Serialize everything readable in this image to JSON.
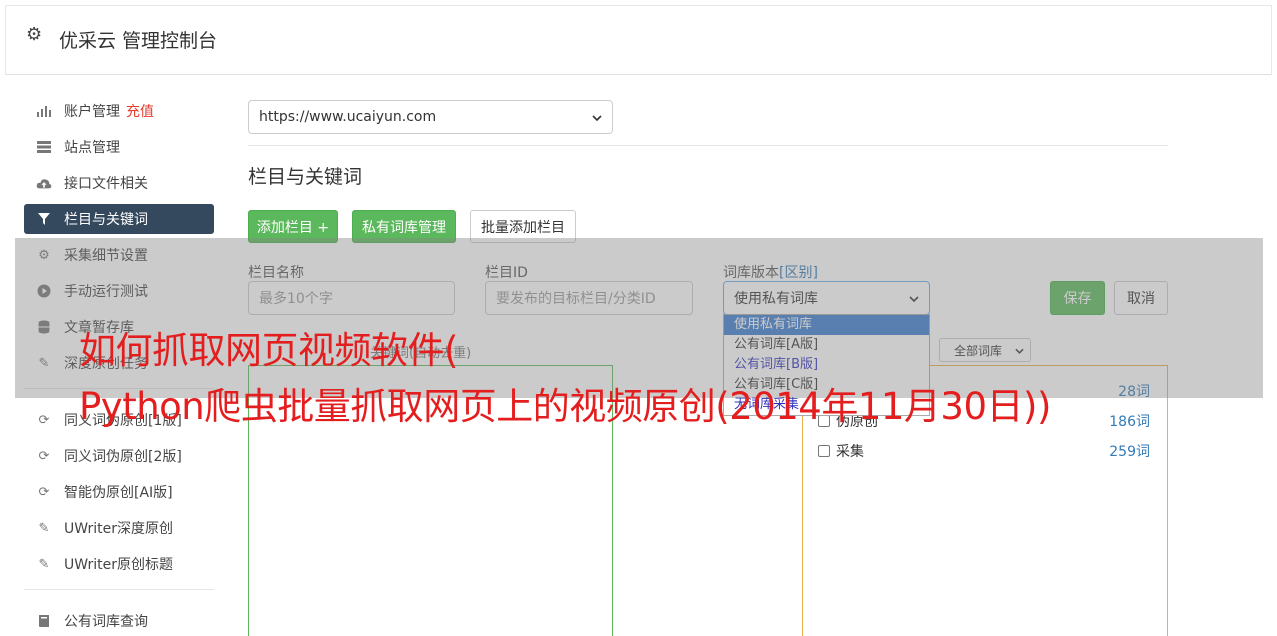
{
  "header": {
    "title": "优采云 管理控制台"
  },
  "sidebar": {
    "group1": [
      {
        "label": "账户管理",
        "extra": "充值",
        "icon": "bar-chart-icon"
      },
      {
        "label": "站点管理",
        "icon": "server-icon"
      },
      {
        "label": "接口文件相关",
        "icon": "cloud-upload-icon"
      },
      {
        "label": "栏目与关键词",
        "icon": "filter-icon",
        "active": true
      },
      {
        "label": "采集细节设置",
        "icon": "gears-icon"
      },
      {
        "label": "手动运行测试",
        "icon": "play-circle-icon"
      },
      {
        "label": "文章暂存库",
        "icon": "database-icon"
      },
      {
        "label": "深度原创任务",
        "icon": "edit-icon"
      }
    ],
    "group2": [
      {
        "label": "同义词伪原创[1版]",
        "icon": "refresh-icon"
      },
      {
        "label": "同义词伪原创[2版]",
        "icon": "refresh-icon"
      },
      {
        "label": "智能伪原创[AI版]",
        "icon": "refresh-icon"
      },
      {
        "label": "UWriter深度原创",
        "icon": "edit-icon"
      },
      {
        "label": "UWriter原创标题",
        "icon": "edit-icon"
      }
    ],
    "group3": [
      {
        "label": "公有词库查询",
        "icon": "book-icon"
      }
    ]
  },
  "main": {
    "site_select": "https://www.ucaiyun.com",
    "section_title": "栏目与关键词",
    "buttons": {
      "add_column": "添加栏目 +",
      "private_lib": "私有词库管理",
      "batch_add": "批量添加栏目"
    },
    "form": {
      "name_label": "栏目名称",
      "name_placeholder": "最多10个字",
      "id_label": "栏目ID",
      "id_placeholder": "要发布的目标栏目/分类ID",
      "lib_label": "词库版本",
      "lib_label_link": "[区别]",
      "lib_selected": "使用私有词库",
      "save": "保存",
      "cancel": "取消"
    },
    "dropdown_options": [
      "使用私有词库",
      "公有词库[A版]",
      "公有词库[B版]",
      "公有词库[C版]",
      "无词库采集"
    ],
    "keywords_hint": "关键词(自动去重)",
    "filter_select": "全部词库",
    "keyword_rows": [
      {
        "name": "",
        "count": "28词"
      },
      {
        "name": "伪原创",
        "count": "186词"
      },
      {
        "name": "采集",
        "count": "259词"
      }
    ]
  },
  "headline": {
    "line1": "如何抓取网页视频软件(",
    "line2": "Python爬虫批量抓取网页上的视频原创(2014年11月30日))"
  },
  "colors": {
    "primary_green": "#5cb85c",
    "active_nav": "#34495e",
    "accent_red": "#e41e1e",
    "link_blue": "#337ab7"
  }
}
